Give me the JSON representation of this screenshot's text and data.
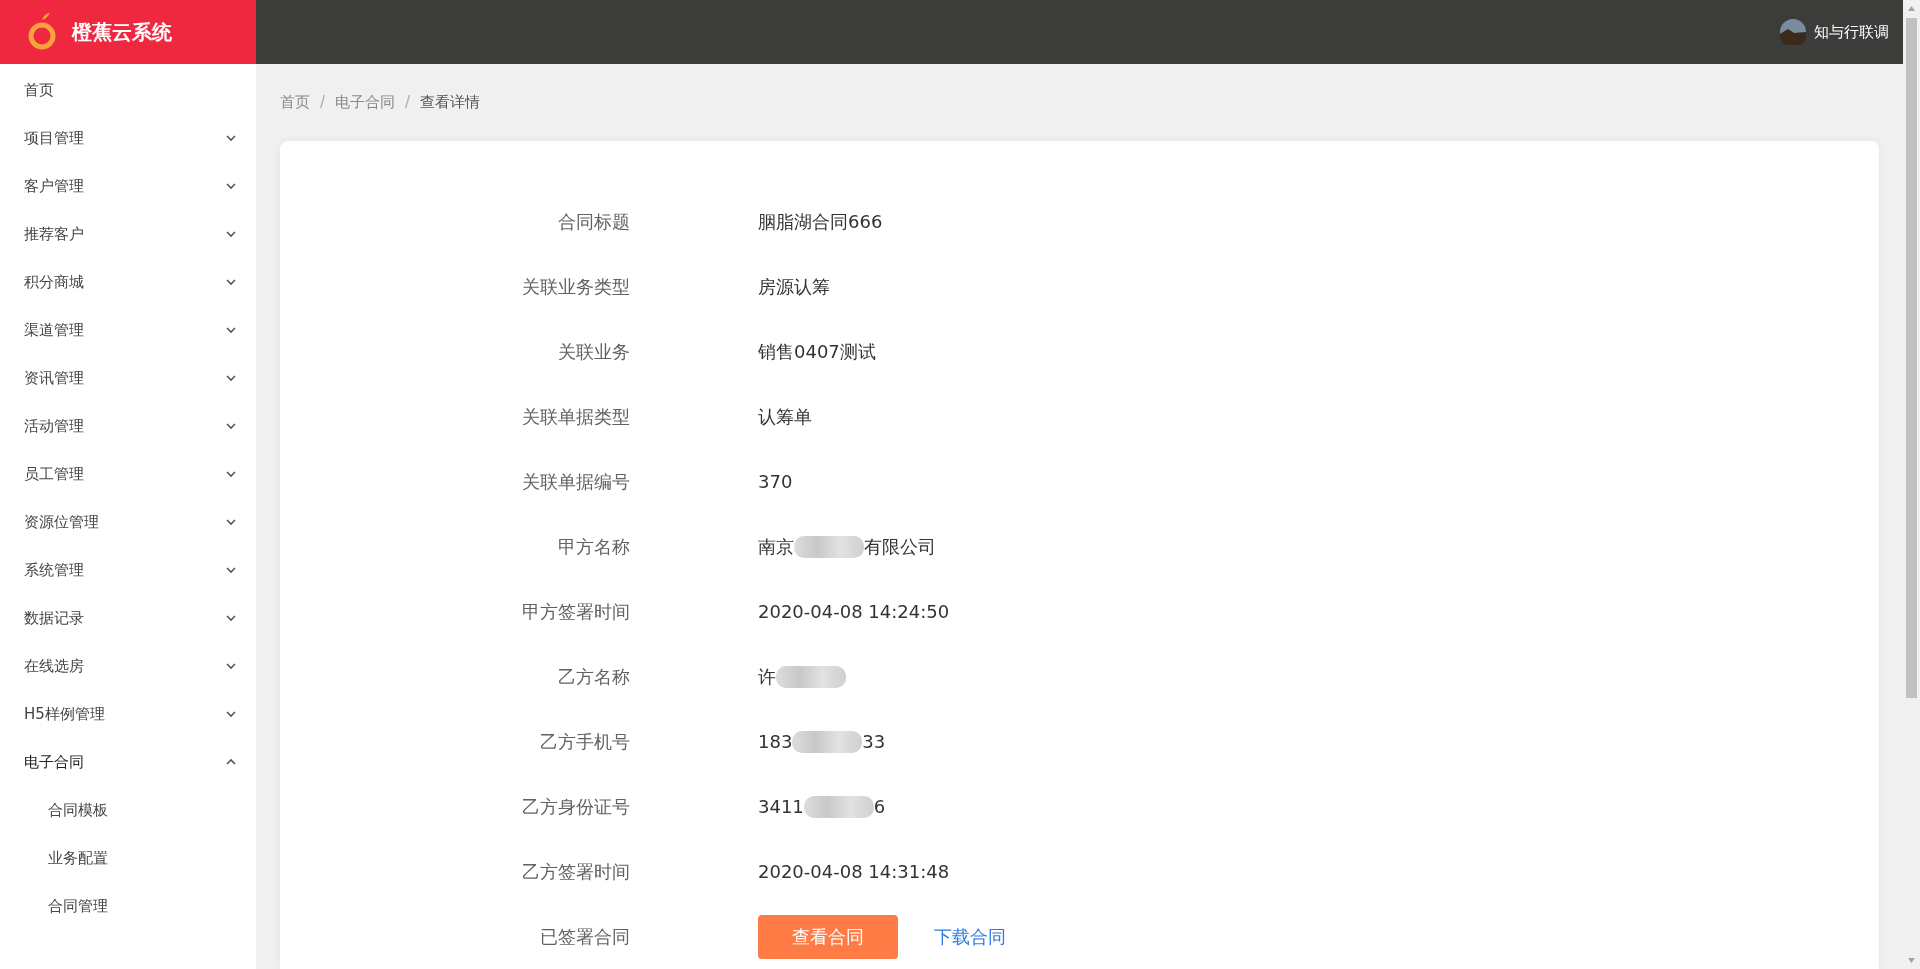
{
  "header": {
    "app_name": "橙蕉云系统",
    "user_name": "知与行联调"
  },
  "sidebar": {
    "items": [
      {
        "label": "首页",
        "kind": "link"
      },
      {
        "label": "项目管理",
        "kind": "group",
        "expanded": false
      },
      {
        "label": "客户管理",
        "kind": "group",
        "expanded": false
      },
      {
        "label": "推荐客户",
        "kind": "group",
        "expanded": false
      },
      {
        "label": "积分商城",
        "kind": "group",
        "expanded": false
      },
      {
        "label": "渠道管理",
        "kind": "group",
        "expanded": false
      },
      {
        "label": "资讯管理",
        "kind": "group",
        "expanded": false
      },
      {
        "label": "活动管理",
        "kind": "group",
        "expanded": false
      },
      {
        "label": "员工管理",
        "kind": "group",
        "expanded": false
      },
      {
        "label": "资源位管理",
        "kind": "group",
        "expanded": false
      },
      {
        "label": "系统管理",
        "kind": "group",
        "expanded": false
      },
      {
        "label": "数据记录",
        "kind": "group",
        "expanded": false
      },
      {
        "label": "在线选房",
        "kind": "group",
        "expanded": false
      },
      {
        "label": "H5样例管理",
        "kind": "group",
        "expanded": false
      },
      {
        "label": "电子合同",
        "kind": "group",
        "expanded": true,
        "children": [
          {
            "label": "合同模板"
          },
          {
            "label": "业务配置"
          },
          {
            "label": "合同管理"
          }
        ]
      }
    ]
  },
  "breadcrumb": [
    {
      "label": "首页",
      "current": false
    },
    {
      "separator": "/",
      "label": "电子合同",
      "current": false
    },
    {
      "separator": "/",
      "label": "查看详情",
      "current": true
    }
  ],
  "details": [
    {
      "kind": "text",
      "label": "合同标题",
      "value": "胭脂湖合同666"
    },
    {
      "kind": "text",
      "label": "关联业务类型",
      "value": "房源认筹"
    },
    {
      "kind": "text",
      "label": "关联业务",
      "value": "销售0407测试"
    },
    {
      "kind": "text",
      "label": "关联单据类型",
      "value": "认筹单"
    },
    {
      "kind": "text",
      "label": "关联单据编号",
      "value": "370"
    },
    {
      "kind": "redacted",
      "label": "甲方名称",
      "value_start": "南京",
      "value_end": "有限公司"
    },
    {
      "kind": "text",
      "label": "甲方签署时间",
      "value": "2020-04-08 14:24:50"
    },
    {
      "kind": "redacted",
      "label": "乙方名称",
      "value_start": "许"
    },
    {
      "kind": "redacted",
      "label": "乙方手机号",
      "value_start": "183",
      "value_end": "33"
    },
    {
      "kind": "redacted",
      "label": "乙方身份证号",
      "value_start": "3411",
      "value_end": "6"
    },
    {
      "kind": "text",
      "label": "乙方签署时间",
      "value": "2020-04-08 14:31:48"
    },
    {
      "kind": "actions",
      "label": "已签署合同",
      "button": "查看合同",
      "link": "下载合同"
    }
  ]
}
